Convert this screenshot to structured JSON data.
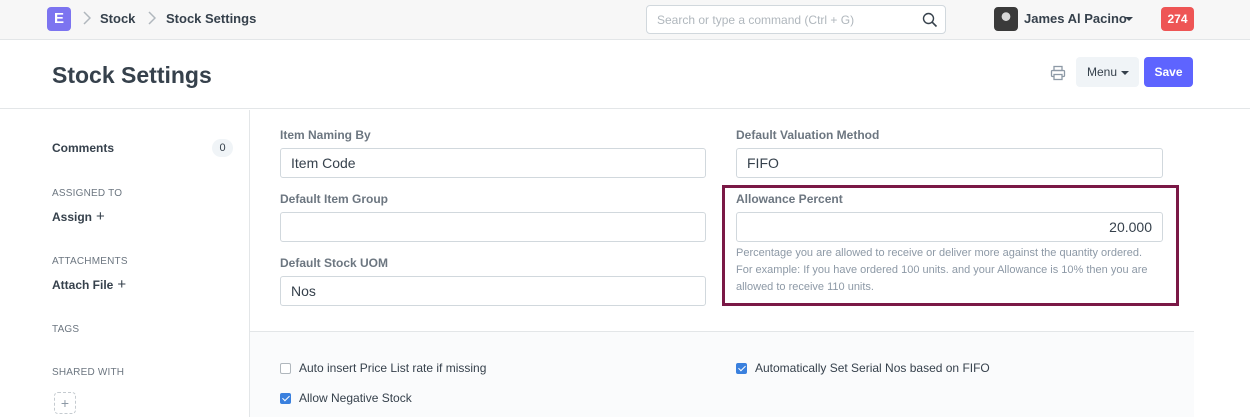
{
  "navbar": {
    "logo_letter": "E",
    "breadcrumbs": [
      "Stock",
      "Stock Settings"
    ],
    "search_placeholder": "Search or type a command (Ctrl + G)",
    "user_name": "James Al Pacino",
    "notification_count": "274"
  },
  "page_head": {
    "title": "Stock Settings",
    "menu_label": "Menu",
    "save_label": "Save"
  },
  "sidebar": {
    "comments_label": "Comments",
    "comments_count": "0",
    "assigned_to_label": "ASSIGNED TO",
    "assign_label": "Assign",
    "attachments_label": "ATTACHMENTS",
    "attach_file_label": "Attach File",
    "tags_label": "TAGS",
    "shared_with_label": "SHARED WITH",
    "shared_add": "+"
  },
  "form": {
    "item_naming_by": {
      "label": "Item Naming By",
      "value": "Item Code"
    },
    "default_item_group": {
      "label": "Default Item Group",
      "value": ""
    },
    "default_stock_uom": {
      "label": "Default Stock UOM",
      "value": "Nos"
    },
    "default_valuation_method": {
      "label": "Default Valuation Method",
      "value": "FIFO"
    },
    "allowance_percent": {
      "label": "Allowance Percent",
      "value": "20.000",
      "help": "Percentage you are allowed to receive or deliver more against the quantity ordered. For example: If you have ordered 100 units. and your Allowance is 10% then you are allowed to receive 110 units."
    },
    "checkboxes": [
      {
        "label": "Auto insert Price List rate if missing",
        "checked": false
      },
      {
        "label": "Allow Negative Stock",
        "checked": true
      },
      {
        "label": "Automatically Set Serial Nos based on FIFO",
        "checked": true
      }
    ]
  },
  "colors": {
    "accent": "#5e64ff",
    "notification": "#ee5555",
    "highlight_border": "#7a1846",
    "checkbox_on": "#3a80de"
  }
}
